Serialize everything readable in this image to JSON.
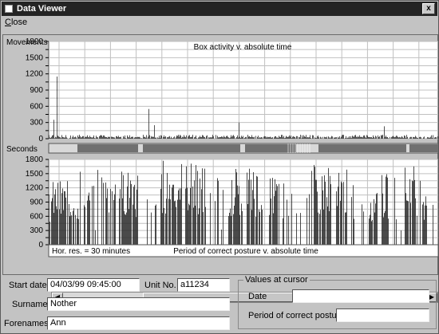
{
  "window": {
    "title": "Data Viewer",
    "close_glyph": "x"
  },
  "menu": [
    {
      "label": "Close"
    }
  ],
  "colors": {
    "background": "#c3c3c3",
    "plot_bg": "#ffffff",
    "bars": "#2a2a2a",
    "grid": "#c0c0c0",
    "posture_band": "#707070"
  },
  "chart_data": [
    {
      "type": "bar",
      "title": "Box activity v. absolute time",
      "ylabel": "Movements",
      "yticks": [
        0,
        150,
        300,
        450,
        600,
        750,
        900,
        1050,
        1200,
        1350,
        1500,
        1650,
        1800
      ],
      "ytick_labels": [
        "0",
        "",
        "300",
        "",
        "600",
        "",
        "900",
        "",
        "1200",
        "",
        "1500",
        "",
        "1800"
      ],
      "ylim": [
        0,
        1800
      ],
      "grid": true,
      "time_unit_minutes": 30,
      "peaks": [
        {
          "bin": 10,
          "value": 1150
        },
        {
          "bin": 6,
          "value": 350
        },
        {
          "bin": 125,
          "value": 550
        },
        {
          "bin": 132,
          "value": 250
        },
        {
          "bin": 238,
          "value": 300
        },
        {
          "bin": 420,
          "value": 230
        }
      ],
      "typical_range": [
        0,
        150
      ]
    },
    {
      "type": "bar",
      "title": "Period of correct posture v. absolute time",
      "ylabel": "Seconds",
      "yticks": [
        0,
        150,
        300,
        450,
        600,
        750,
        900,
        1050,
        1200,
        1350,
        1500,
        1650,
        1800
      ],
      "ytick_labels": [
        "0",
        "",
        "300",
        "",
        "600",
        "",
        "900",
        "",
        "1200",
        "",
        "1500",
        "",
        "1800"
      ],
      "ylim": [
        0,
        1800
      ],
      "grid": true,
      "note": "Hor. res. = 30 minutes",
      "active_blocks": [
        {
          "start": 0,
          "end": 38,
          "level": 1350
        },
        {
          "start": 44,
          "end": 52,
          "level": 1200
        },
        {
          "start": 66,
          "end": 84,
          "level": 1500
        },
        {
          "start": 88,
          "end": 112,
          "level": 1600
        },
        {
          "start": 140,
          "end": 168,
          "level": 1800
        },
        {
          "start": 172,
          "end": 196,
          "level": 1750
        },
        {
          "start": 226,
          "end": 244,
          "level": 1700
        },
        {
          "start": 248,
          "end": 268,
          "level": 1650
        },
        {
          "start": 276,
          "end": 290,
          "level": 1500
        },
        {
          "start": 332,
          "end": 354,
          "level": 1700
        },
        {
          "start": 360,
          "end": 374,
          "level": 1600
        },
        {
          "start": 402,
          "end": 412,
          "level": 1400
        },
        {
          "start": 416,
          "end": 426,
          "level": 1500
        },
        {
          "start": 446,
          "end": 462,
          "level": 1700
        },
        {
          "start": 466,
          "end": 474,
          "level": 1500
        }
      ]
    }
  ],
  "scrollbar": {
    "position_fraction": 0.25
  },
  "form": {
    "start_date_label": "Start date",
    "start_date": "04/03/99 09:45:00",
    "unit_no_label": "Unit No.",
    "unit_no": "a11234",
    "surname_label": "Surname",
    "surname": "Nother",
    "forenames_label": "Forenames",
    "forenames": "Ann"
  },
  "values_at_cursor": {
    "legend": "Values at cursor",
    "date_label": "Date",
    "date": "",
    "posture_label": "Period of correct posture",
    "posture": ""
  }
}
